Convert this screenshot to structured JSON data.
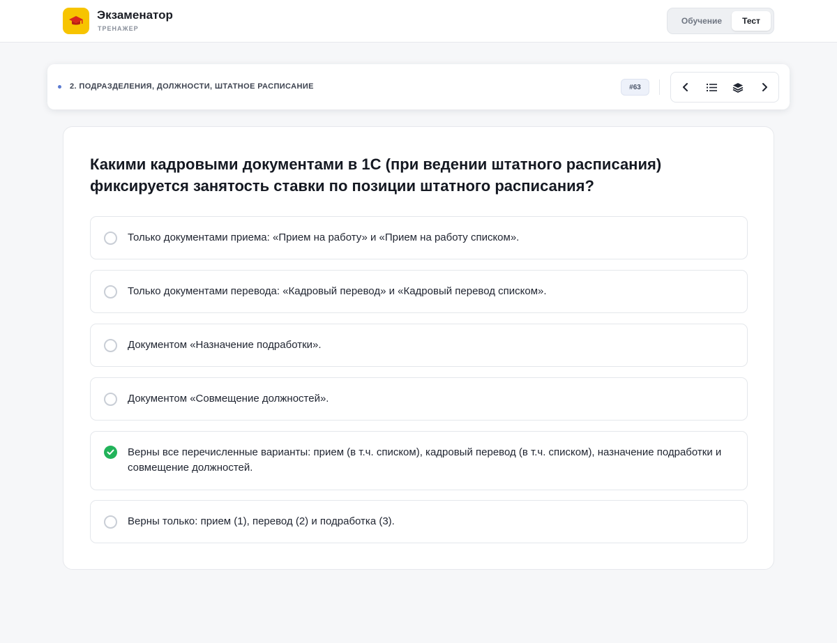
{
  "app": {
    "title": "Экзаменатор",
    "subtitle": "ТРЕНАЖЕР",
    "logo_icon": "graduation-cap-icon",
    "brand_color": "#f7c400"
  },
  "mode_switch": {
    "learn_label": "Обучение",
    "test_label": "Тест",
    "active": "Тест"
  },
  "topbar": {
    "section_title": "2. ПОДРАЗДЕЛЕНИЯ, ДОЛЖНОСТИ, ШТАТНОЕ РАСПИСАНИЕ",
    "question_number": "#63",
    "nav_icons": [
      "chevron-left-icon",
      "list-icon",
      "layers-icon",
      "chevron-right-icon"
    ]
  },
  "question": {
    "text": "Какими кадровыми документами в 1С (при ведении штатного расписания) фиксируется занятость ставки по позиции штатного расписания?",
    "options": [
      {
        "text": "Только документами приема: «Прием на работу» и «Прием на работу списком».",
        "selected": false
      },
      {
        "text": "Только документами перевода: «Кадровый перевод» и «Кадровый перевод списком».",
        "selected": false
      },
      {
        "text": "Документом «Назначение подработки».",
        "selected": false
      },
      {
        "text": "Документом «Совмещение должностей».",
        "selected": false
      },
      {
        "text": "Верны все перечисленные варианты: прием (в т.ч. списком), кадровый перевод (в т.ч. списком), назначение подработки и совмещение должностей.",
        "selected": true
      },
      {
        "text": "Верны только: прием (1), перевод (2) и подработка (3).",
        "selected": false
      }
    ],
    "correct_color": "#22b35a"
  }
}
